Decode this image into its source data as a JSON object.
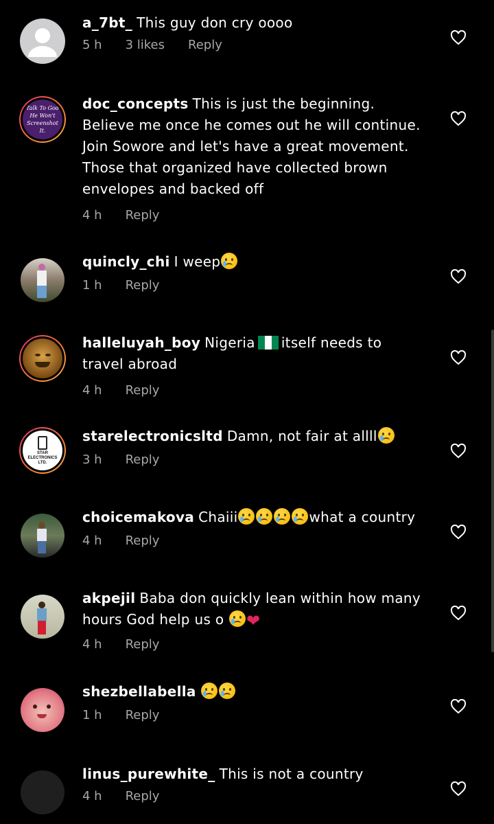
{
  "reply_label": "Reply",
  "comments": [
    {
      "username": "a_7bt_",
      "text": "This guy don cry oooo",
      "time": "5 h",
      "likes": "3 likes"
    },
    {
      "username": "doc_concepts",
      "text": "This is just the beginning. Believe me once he comes out he will continue. Join Sowore and let's have a great movement. Those that organized have collected brown envelopes and backed off",
      "time": "4 h",
      "avatar_text": "Talk To God He Won't Screenshot It."
    },
    {
      "username": "quincly_chi",
      "text": "I weep",
      "time": "1 h"
    },
    {
      "username": "halleluyah_boy",
      "text_before": "Nigeria",
      "text_after": "itself needs to travel abroad",
      "time": "4 h"
    },
    {
      "username": "starelectronicsltd",
      "text": "Damn, not fair at allll",
      "time": "3 h",
      "avatar_text": "STAR ELECTRONICS LTD."
    },
    {
      "username": "choicemakova",
      "text_before": "Chaiii",
      "text_after": "what a country",
      "time": "4 h"
    },
    {
      "username": "akpejil",
      "text": "Baba don quickly lean within how many hours God help us o",
      "time": "4 h"
    },
    {
      "username": "shezbellabella",
      "text": "",
      "time": "1 h"
    },
    {
      "username": "linus_purewhite_",
      "text": "This is not a country",
      "time": "4 h"
    }
  ],
  "colors": {
    "accent_ring_start": "#e1306c",
    "accent_ring_end": "#fcaf45",
    "meta_gray": "#a8a8a8",
    "flag_green": "#008751"
  }
}
